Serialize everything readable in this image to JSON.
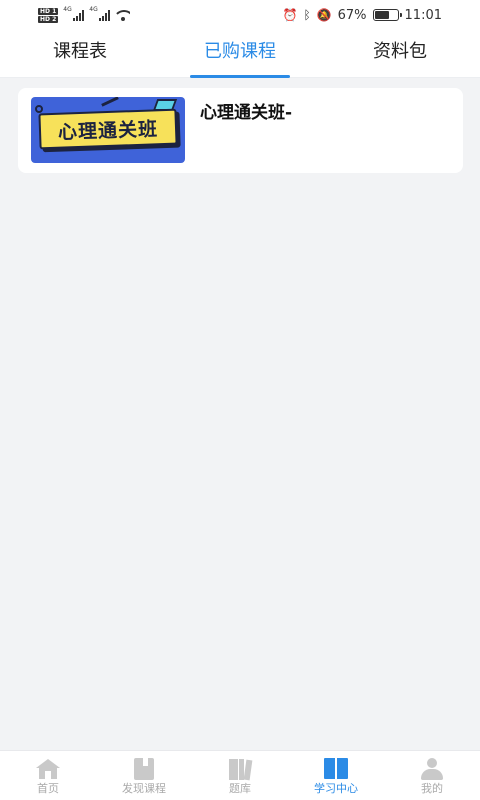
{
  "status_bar": {
    "hd1": "HD 1",
    "hd2": "HD 2",
    "net1": "4G",
    "net2": "4G",
    "battery_percent": "67%",
    "battery_level": 0.67,
    "time": "11:01"
  },
  "tabs": [
    {
      "label": "课程表",
      "active": false
    },
    {
      "label": "已购课程",
      "active": true
    },
    {
      "label": "资料包",
      "active": false
    }
  ],
  "courses": [
    {
      "title": "心理通关班-",
      "thumbnail_text": "心理通关班"
    }
  ],
  "bottom_nav": [
    {
      "label": "首页",
      "icon": "home-icon",
      "active": false
    },
    {
      "label": "发现课程",
      "icon": "book-icon",
      "active": false
    },
    {
      "label": "题库",
      "icon": "question-bank-icon",
      "active": false
    },
    {
      "label": "学习中心",
      "icon": "open-book-icon",
      "active": true
    },
    {
      "label": "我的",
      "icon": "profile-icon",
      "active": false
    }
  ],
  "colors": {
    "accent": "#2b8be6",
    "background": "#f2f3f5",
    "inactive_nav": "#aaaaaa",
    "thumbnail_bg": "#3f63d9",
    "thumbnail_banner": "#f7e15a"
  }
}
